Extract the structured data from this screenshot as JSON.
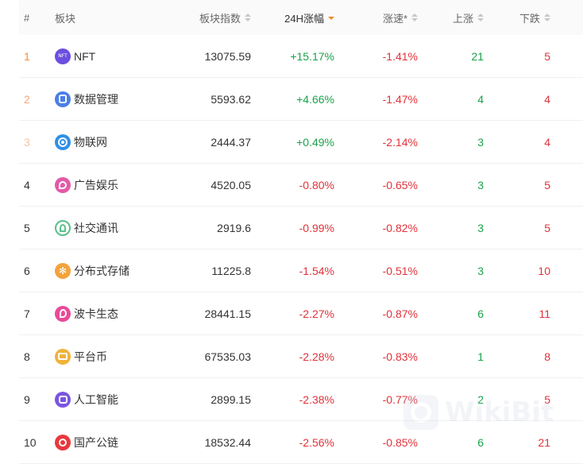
{
  "header": {
    "rank": "#",
    "sector": "板块",
    "index": "板块指数",
    "change24h": "24H涨幅",
    "speed": "涨速*",
    "up": "上涨",
    "down": "下跌"
  },
  "rows": [
    {
      "rank": "1",
      "name": "NFT",
      "index": "13075.59",
      "change": "+15.17%",
      "speed": "-1.41%",
      "up": "21",
      "down": "5",
      "icon": "nft-icon"
    },
    {
      "rank": "2",
      "name": "数据管理",
      "index": "5593.62",
      "change": "+4.66%",
      "speed": "-1.47%",
      "up": "4",
      "down": "4",
      "icon": "database-icon"
    },
    {
      "rank": "3",
      "name": "物联网",
      "index": "2444.37",
      "change": "+0.49%",
      "speed": "-2.14%",
      "up": "3",
      "down": "4",
      "icon": "iot-icon"
    },
    {
      "rank": "4",
      "name": "广告娱乐",
      "index": "4520.05",
      "change": "-0.80%",
      "speed": "-0.65%",
      "up": "3",
      "down": "5",
      "icon": "ads-icon"
    },
    {
      "rank": "5",
      "name": "社交通讯",
      "index": "2919.6",
      "change": "-0.99%",
      "speed": "-0.82%",
      "up": "3",
      "down": "5",
      "icon": "social-icon"
    },
    {
      "rank": "6",
      "name": "分布式存储",
      "index": "11225.8",
      "change": "-1.54%",
      "speed": "-0.51%",
      "up": "3",
      "down": "10",
      "icon": "storage-icon"
    },
    {
      "rank": "7",
      "name": "波卡生态",
      "index": "28441.15",
      "change": "-2.27%",
      "speed": "-0.87%",
      "up": "6",
      "down": "11",
      "icon": "polkadot-icon"
    },
    {
      "rank": "8",
      "name": "平台币",
      "index": "67535.03",
      "change": "-2.28%",
      "speed": "-0.83%",
      "up": "1",
      "down": "8",
      "icon": "platform-coin-icon"
    },
    {
      "rank": "9",
      "name": "人工智能",
      "index": "2899.15",
      "change": "-2.38%",
      "speed": "-0.77%",
      "up": "2",
      "down": "5",
      "icon": "ai-icon"
    },
    {
      "rank": "10",
      "name": "国产公链",
      "index": "18532.44",
      "change": "-2.56%",
      "speed": "-0.85%",
      "up": "6",
      "down": "21",
      "icon": "public-chain-icon"
    }
  ],
  "watermark": {
    "text": "WikiBit"
  },
  "colors": {
    "up": "#1aa34a",
    "down": "#e0323a",
    "sort_active": "#f08c2e"
  }
}
